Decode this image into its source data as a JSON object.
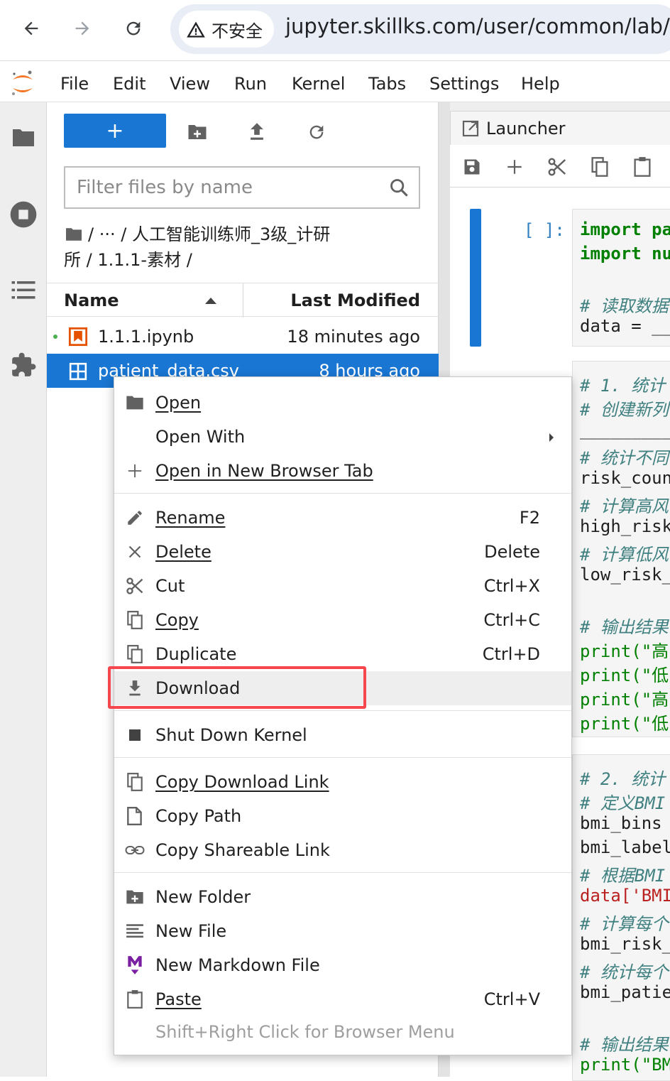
{
  "browser": {
    "security_label": "不安全",
    "url": "jupyter.skillks.com/user/common/lab/tre"
  },
  "menubar": {
    "items": [
      "File",
      "Edit",
      "View",
      "Run",
      "Kernel",
      "Tabs",
      "Settings",
      "Help"
    ]
  },
  "filebrowser": {
    "new_button_label": "+",
    "filter_placeholder": "Filter files by name",
    "breadcrumb_line1": "/  ···  / 人工智能训练师_3级_计研",
    "breadcrumb_line2": "所 / 1.1.1-素材 /",
    "columns": {
      "name": "Name",
      "modified": "Last Modified"
    },
    "files": [
      {
        "name": "1.1.1.ipynb",
        "modified": "18 minutes ago"
      },
      {
        "name": "patient_data.csv",
        "modified": "8 hours ago"
      }
    ]
  },
  "launcher_tab": {
    "label": "Launcher"
  },
  "notebook": {
    "prompt": "[ ]:",
    "cell1": [
      "import pa",
      "import nu",
      "",
      "# 读取数据",
      "data = __"
    ],
    "cell2": [
      "# 1. 统计",
      "# 创建新列",
      "__________",
      "# 统计不同",
      "risk_coun",
      "# 计算高风",
      "high_risk",
      "# 计算低风",
      "low_risk_",
      "",
      "# 输出结果",
      "print(\"高",
      "print(\"低",
      "print(\"高",
      "print(\"低"
    ],
    "cell3": [
      "# 2. 统计",
      "# 定义BMI",
      "bmi_bins",
      "bmi_label",
      "# 根据BMI",
      "data['BMI",
      "# 计算每个",
      "bmi_risk_",
      "# 统计每个",
      "bmi_patie",
      "",
      "# 输出结果",
      "print(\"BM"
    ]
  },
  "context_menu": {
    "items": [
      {
        "label": "Open",
        "shortcut": "",
        "icon": "folder-icon"
      },
      {
        "label": "Open With",
        "shortcut": "",
        "icon": ""
      },
      {
        "label": "Open in New Browser Tab",
        "shortcut": "",
        "icon": "plus-icon"
      },
      {
        "label": "Rename",
        "shortcut": "F2",
        "icon": "pencil-icon"
      },
      {
        "label": "Delete",
        "shortcut": "Delete",
        "icon": "close-icon"
      },
      {
        "label": "Cut",
        "shortcut": "Ctrl+X",
        "icon": "scissors-icon"
      },
      {
        "label": "Copy",
        "shortcut": "Ctrl+C",
        "icon": "copy-icon"
      },
      {
        "label": "Duplicate",
        "shortcut": "Ctrl+D",
        "icon": "duplicate-icon"
      },
      {
        "label": "Download",
        "shortcut": "",
        "icon": "download-icon"
      },
      {
        "label": "Shut Down Kernel",
        "shortcut": "",
        "icon": "stop-icon"
      },
      {
        "label": "Copy Download Link",
        "shortcut": "",
        "icon": "copy-icon"
      },
      {
        "label": "Copy Path",
        "shortcut": "",
        "icon": "file-icon"
      },
      {
        "label": "Copy Shareable Link",
        "shortcut": "",
        "icon": "link-icon"
      },
      {
        "label": "New Folder",
        "shortcut": "",
        "icon": "new-folder-icon"
      },
      {
        "label": "New File",
        "shortcut": "",
        "icon": "text-file-icon"
      },
      {
        "label": "New Markdown File",
        "shortcut": "",
        "icon": "markdown-icon"
      },
      {
        "label": "Paste",
        "shortcut": "Ctrl+V",
        "icon": "paste-icon"
      }
    ],
    "hint": "Shift+Right Click for Browser Menu"
  },
  "colors": {
    "accent": "#1976d2",
    "highlight_box": "#f5474d",
    "jupyter_orange": "#f37726"
  }
}
